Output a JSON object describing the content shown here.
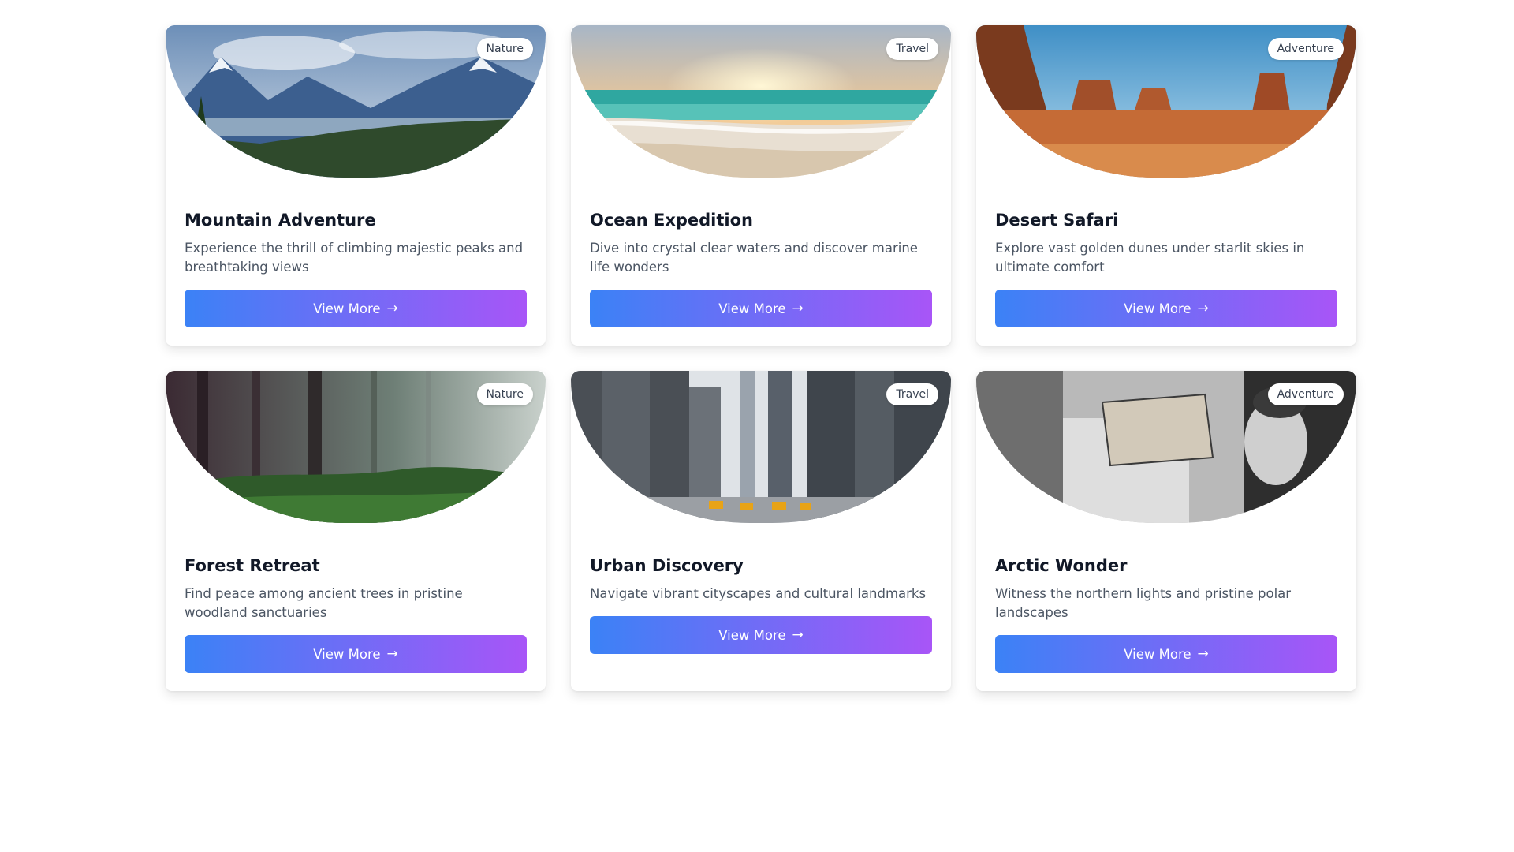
{
  "cards": [
    {
      "badge": "Nature",
      "title": "Mountain Adventure",
      "description": "Experience the thrill of climbing majestic peaks and breathtaking views",
      "button_label": "View More",
      "button_icon": "→",
      "image": "mountain-lake-landscape"
    },
    {
      "badge": "Travel",
      "title": "Ocean Expedition",
      "description": "Dive into crystal clear waters and discover marine life wonders",
      "button_label": "View More",
      "button_icon": "→",
      "image": "beach-sunset"
    },
    {
      "badge": "Adventure",
      "title": "Desert Safari",
      "description": "Explore vast golden dunes under starlit skies in ultimate comfort",
      "button_label": "View More",
      "button_icon": "→",
      "image": "desert-canyon-mesas"
    },
    {
      "badge": "Nature",
      "title": "Forest Retreat",
      "description": "Find peace among ancient trees in pristine woodland sanctuaries",
      "button_label": "View More",
      "button_icon": "→",
      "image": "misty-forest"
    },
    {
      "badge": "Travel",
      "title": "Urban Discovery",
      "description": "Navigate vibrant cityscapes and cultural landmarks",
      "button_label": "View More",
      "button_icon": "→",
      "image": "city-street-skyscrapers"
    },
    {
      "badge": "Adventure",
      "title": "Arctic Wonder",
      "description": "Witness the northern lights and pristine polar landscapes",
      "button_label": "View More",
      "button_icon": "→",
      "image": "bw-man-holding-sign"
    }
  ]
}
